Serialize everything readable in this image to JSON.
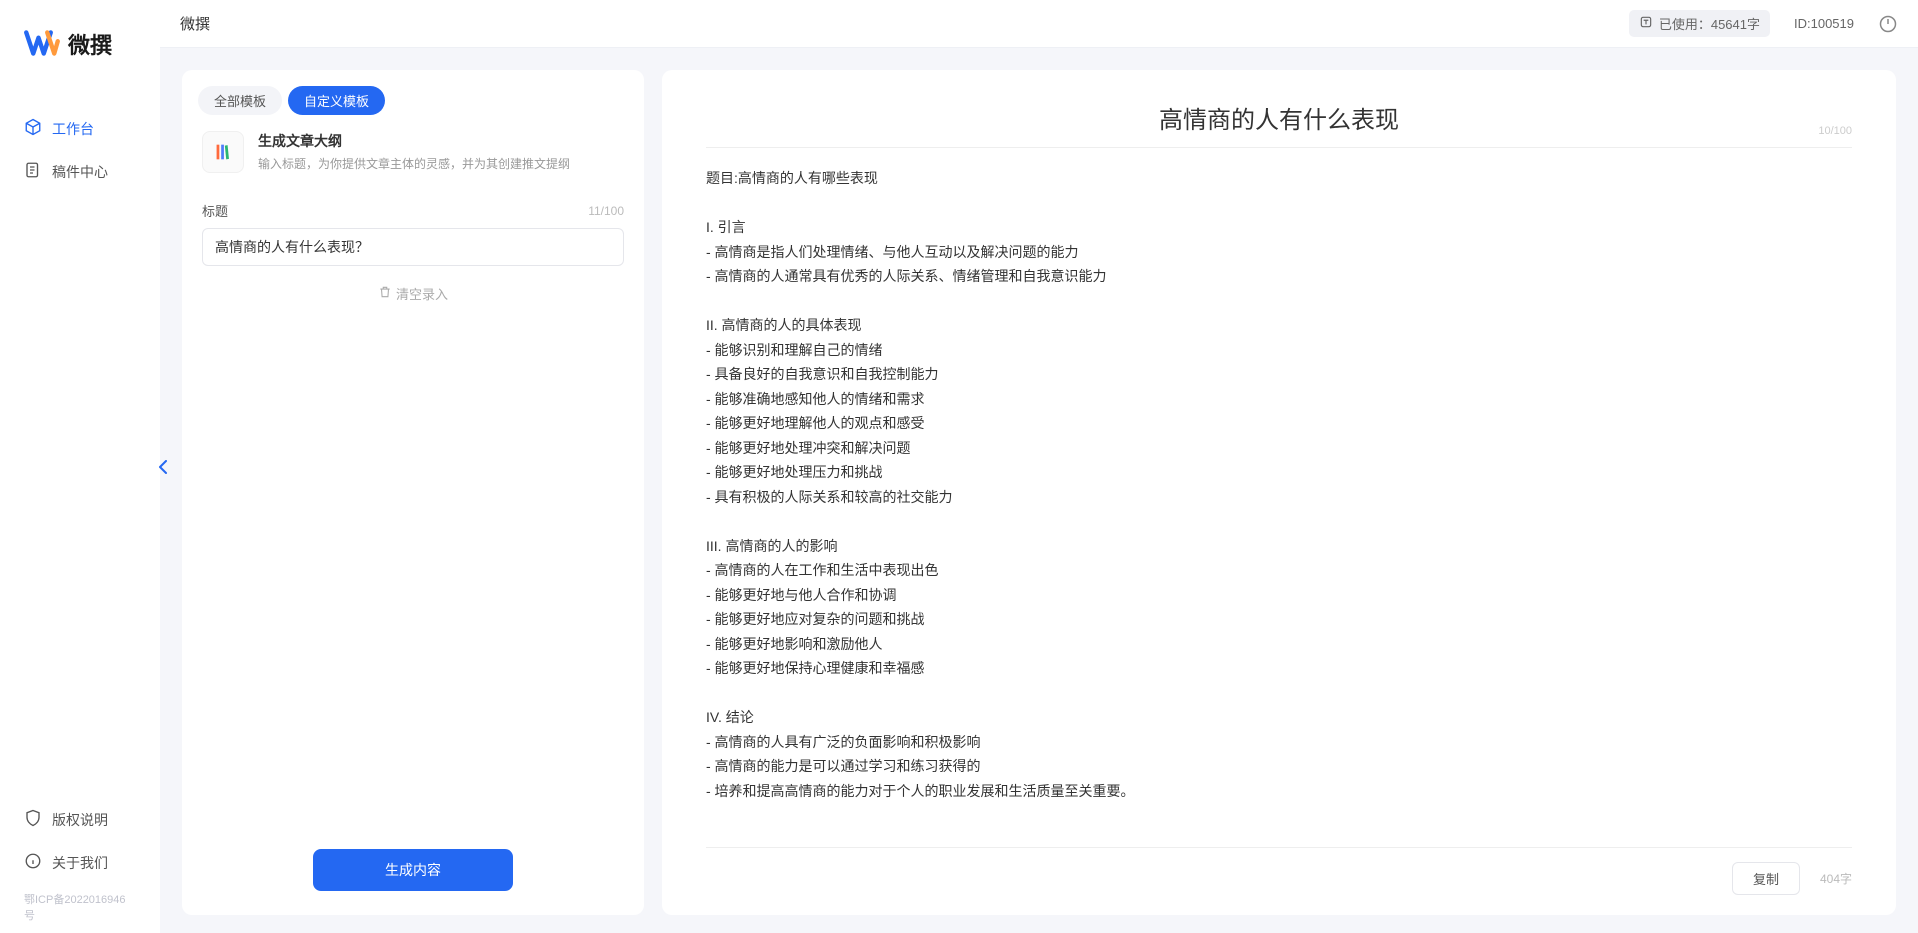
{
  "app": {
    "logo_text": "微撰",
    "topbar_title": "微撰",
    "usage_label": "已使用：45641字",
    "id_label": "ID:100519"
  },
  "sidebar": {
    "items": [
      {
        "label": "工作台",
        "icon": "cube",
        "active": true
      },
      {
        "label": "稿件中心",
        "icon": "folder",
        "active": false
      }
    ],
    "bottom_items": [
      {
        "label": "版权说明",
        "icon": "shield"
      },
      {
        "label": "关于我们",
        "icon": "info"
      }
    ],
    "icp": "鄂ICP备2022016946号"
  },
  "left": {
    "tabs": [
      {
        "label": "全部模板",
        "active": false
      },
      {
        "label": "自定义模板",
        "active": true
      }
    ],
    "template": {
      "title": "生成文章大纲",
      "desc": "输入标题，为你提供文章主体的灵感，并为其创建推文提纲"
    },
    "form": {
      "label": "标题",
      "counter": "11/100",
      "input_value": "高情商的人有什么表现？",
      "clear_label": "清空录入"
    },
    "generate_label": "生成内容"
  },
  "right": {
    "title": "高情商的人有什么表现",
    "title_counter": "10/100",
    "body": "题目:高情商的人有哪些表现\n\nI. 引言\n- 高情商是指人们处理情绪、与他人互动以及解决问题的能力\n- 高情商的人通常具有优秀的人际关系、情绪管理和自我意识能力\n\nII. 高情商的人的具体表现\n- 能够识别和理解自己的情绪\n- 具备良好的自我意识和自我控制能力\n- 能够准确地感知他人的情绪和需求\n- 能够更好地理解他人的观点和感受\n- 能够更好地处理冲突和解决问题\n- 能够更好地处理压力和挑战\n- 具有积极的人际关系和较高的社交能力\n\nIII. 高情商的人的影响\n- 高情商的人在工作和生活中表现出色\n- 能够更好地与他人合作和协调\n- 能够更好地应对复杂的问题和挑战\n- 能够更好地影响和激励他人\n- 能够更好地保持心理健康和幸福感\n\nIV. 结论\n- 高情商的人具有广泛的负面影响和积极影响\n- 高情商的能力是可以通过学习和练习获得的\n- 培养和提高高情商的能力对于个人的职业发展和生活质量至关重要。",
    "copy_label": "复制",
    "word_count": "404字"
  }
}
